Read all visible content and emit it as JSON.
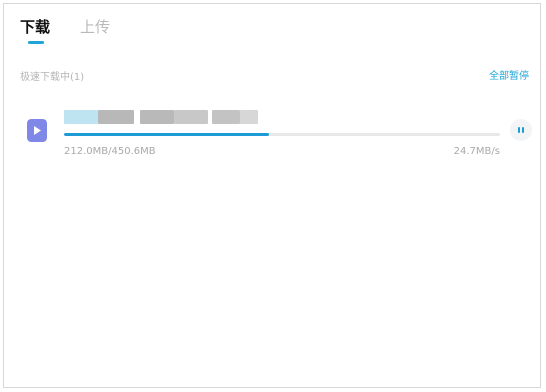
{
  "tabs": [
    {
      "label": "下载",
      "active": true
    },
    {
      "label": "上传",
      "active": false
    }
  ],
  "section": {
    "title": "极速下载中(1)",
    "pause_all_label": "全部暂停"
  },
  "download": {
    "file_name_redacted": true,
    "progress": 0.47,
    "size_text": "212.0MB/450.6MB",
    "speed_text": "24.7MB/s",
    "icon": "video-file-icon",
    "action_icon": "pause-icon"
  },
  "colors": {
    "accent": "#1fa5d8",
    "progress": "#1d9bd6",
    "file_icon_bg": "#7f88e6",
    "text_primary": "#111111",
    "text_muted": "#b5b5b5"
  }
}
